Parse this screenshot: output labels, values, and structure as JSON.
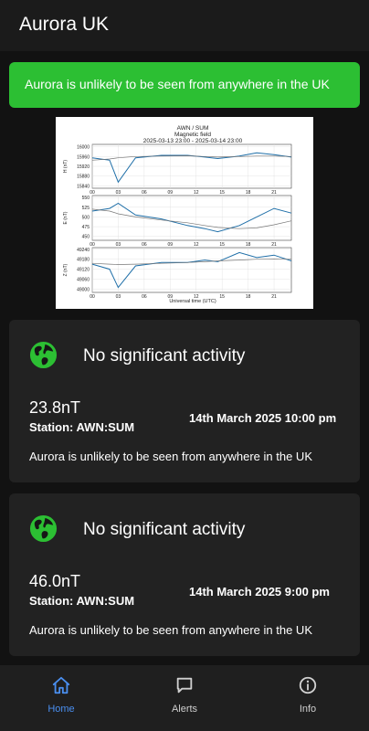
{
  "app": {
    "title": "Aurora UK"
  },
  "status_banner": {
    "text": "Aurora is unlikely to be seen from anywhere in the UK",
    "color": "#2cbf33"
  },
  "chart": {
    "title_lines": [
      "AWN / SUM",
      "Magnetic field",
      "2025-03-13 23:00 - 2025-03-14 23:00"
    ],
    "xlabel": "Universal time (UTC)",
    "x_ticks": [
      "00",
      "03",
      "06",
      "09",
      "12",
      "15",
      "18",
      "21"
    ],
    "panels": [
      {
        "ylabel": "H (nT)",
        "ticks": [
          "16000",
          "15960",
          "15920",
          "15880",
          "15840"
        ]
      },
      {
        "ylabel": "E (nT)",
        "ticks": [
          "550",
          "525",
          "500",
          "475",
          "450"
        ]
      },
      {
        "ylabel": "Z (nT)",
        "ticks": [
          "49240",
          "49180",
          "49120",
          "49060",
          "49000"
        ]
      }
    ]
  },
  "chart_data": {
    "type": "line",
    "title": "AWN / SUM Magnetic field 2025-03-13 23:00 - 2025-03-14 23:00",
    "xlabel": "Universal time (UTC)",
    "x_hours": [
      0,
      2,
      3,
      5,
      8,
      11,
      13,
      14.5,
      17,
      19,
      21,
      23
    ],
    "panels": [
      {
        "ylabel": "H (nT)",
        "ylim": [
          15830,
          16010
        ],
        "series": [
          {
            "values": [
              15955,
              15945,
              15855,
              15955,
              15965,
              15965,
              15958,
              15952,
              15962,
              15975,
              15968,
              15958
            ]
          },
          {
            "values": [
              15945,
              15950,
              15955,
              15960,
              15962,
              15963,
              15960,
              15958,
              15960,
              15962,
              15962,
              15960
            ]
          }
        ]
      },
      {
        "ylabel": "E (nT)",
        "ylim": [
          440,
          555
        ],
        "series": [
          {
            "values": [
              515,
              522,
              535,
              505,
              495,
              478,
              470,
              462,
              478,
              500,
              522,
              510
            ]
          },
          {
            "values": [
              520,
              515,
              508,
              500,
              492,
              485,
              478,
              473,
              470,
              472,
              480,
              490
            ]
          }
        ]
      },
      {
        "ylabel": "Z (nT)",
        "ylim": [
          48980,
          49250
        ],
        "series": [
          {
            "values": [
              49150,
              49120,
              49010,
              49140,
              49160,
              49160,
              49175,
              49165,
              49220,
              49190,
              49205,
              49170
            ]
          },
          {
            "values": [
              49155,
              49150,
              49148,
              49150,
              49155,
              49160,
              49165,
              49170,
              49175,
              49180,
              49182,
              49180
            ]
          }
        ]
      }
    ]
  },
  "cards": [
    {
      "heading": "No significant activity",
      "value": "23.8nT",
      "station": "Station: AWN:SUM",
      "time": "14th March 2025 10:00 pm",
      "note": "Aurora is unlikely to be seen from anywhere in the UK",
      "icon": "globe-icon"
    },
    {
      "heading": "No significant activity",
      "value": "46.0nT",
      "station": "Station: AWN:SUM",
      "time": "14th March 2025 9:00 pm",
      "note": "Aurora is unlikely to be seen from anywhere in the UK",
      "icon": "globe-icon"
    }
  ],
  "nav": {
    "items": [
      {
        "label": "Home",
        "icon": "home-icon",
        "active": true
      },
      {
        "label": "Alerts",
        "icon": "chat-bubble-icon",
        "active": false
      },
      {
        "label": "Info",
        "icon": "info-icon",
        "active": false
      }
    ]
  },
  "colors": {
    "accent": "#4a8ff0",
    "ok_green": "#2cbf33",
    "plot_line": "#1f6fa8"
  }
}
